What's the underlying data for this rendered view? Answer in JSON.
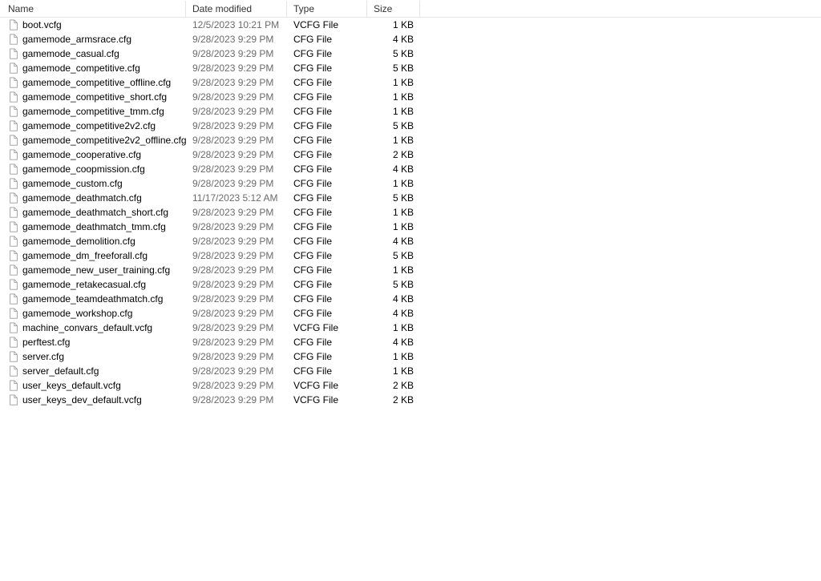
{
  "columns": {
    "name": "Name",
    "date": "Date modified",
    "type": "Type",
    "size": "Size"
  },
  "files": [
    {
      "name": "boot.vcfg",
      "date": "12/5/2023 10:21 PM",
      "type": "VCFG File",
      "size": "1 KB"
    },
    {
      "name": "gamemode_armsrace.cfg",
      "date": "9/28/2023 9:29 PM",
      "type": "CFG File",
      "size": "4 KB"
    },
    {
      "name": "gamemode_casual.cfg",
      "date": "9/28/2023 9:29 PM",
      "type": "CFG File",
      "size": "5 KB"
    },
    {
      "name": "gamemode_competitive.cfg",
      "date": "9/28/2023 9:29 PM",
      "type": "CFG File",
      "size": "5 KB"
    },
    {
      "name": "gamemode_competitive_offline.cfg",
      "date": "9/28/2023 9:29 PM",
      "type": "CFG File",
      "size": "1 KB"
    },
    {
      "name": "gamemode_competitive_short.cfg",
      "date": "9/28/2023 9:29 PM",
      "type": "CFG File",
      "size": "1 KB"
    },
    {
      "name": "gamemode_competitive_tmm.cfg",
      "date": "9/28/2023 9:29 PM",
      "type": "CFG File",
      "size": "1 KB"
    },
    {
      "name": "gamemode_competitive2v2.cfg",
      "date": "9/28/2023 9:29 PM",
      "type": "CFG File",
      "size": "5 KB"
    },
    {
      "name": "gamemode_competitive2v2_offline.cfg",
      "date": "9/28/2023 9:29 PM",
      "type": "CFG File",
      "size": "1 KB"
    },
    {
      "name": "gamemode_cooperative.cfg",
      "date": "9/28/2023 9:29 PM",
      "type": "CFG File",
      "size": "2 KB"
    },
    {
      "name": "gamemode_coopmission.cfg",
      "date": "9/28/2023 9:29 PM",
      "type": "CFG File",
      "size": "4 KB"
    },
    {
      "name": "gamemode_custom.cfg",
      "date": "9/28/2023 9:29 PM",
      "type": "CFG File",
      "size": "1 KB"
    },
    {
      "name": "gamemode_deathmatch.cfg",
      "date": "11/17/2023 5:12 AM",
      "type": "CFG File",
      "size": "5 KB"
    },
    {
      "name": "gamemode_deathmatch_short.cfg",
      "date": "9/28/2023 9:29 PM",
      "type": "CFG File",
      "size": "1 KB"
    },
    {
      "name": "gamemode_deathmatch_tmm.cfg",
      "date": "9/28/2023 9:29 PM",
      "type": "CFG File",
      "size": "1 KB"
    },
    {
      "name": "gamemode_demolition.cfg",
      "date": "9/28/2023 9:29 PM",
      "type": "CFG File",
      "size": "4 KB"
    },
    {
      "name": "gamemode_dm_freeforall.cfg",
      "date": "9/28/2023 9:29 PM",
      "type": "CFG File",
      "size": "5 KB"
    },
    {
      "name": "gamemode_new_user_training.cfg",
      "date": "9/28/2023 9:29 PM",
      "type": "CFG File",
      "size": "1 KB"
    },
    {
      "name": "gamemode_retakecasual.cfg",
      "date": "9/28/2023 9:29 PM",
      "type": "CFG File",
      "size": "5 KB"
    },
    {
      "name": "gamemode_teamdeathmatch.cfg",
      "date": "9/28/2023 9:29 PM",
      "type": "CFG File",
      "size": "4 KB"
    },
    {
      "name": "gamemode_workshop.cfg",
      "date": "9/28/2023 9:29 PM",
      "type": "CFG File",
      "size": "4 KB"
    },
    {
      "name": "machine_convars_default.vcfg",
      "date": "9/28/2023 9:29 PM",
      "type": "VCFG File",
      "size": "1 KB"
    },
    {
      "name": "perftest.cfg",
      "date": "9/28/2023 9:29 PM",
      "type": "CFG File",
      "size": "4 KB"
    },
    {
      "name": "server.cfg",
      "date": "9/28/2023 9:29 PM",
      "type": "CFG File",
      "size": "1 KB"
    },
    {
      "name": "server_default.cfg",
      "date": "9/28/2023 9:29 PM",
      "type": "CFG File",
      "size": "1 KB"
    },
    {
      "name": "user_keys_default.vcfg",
      "date": "9/28/2023 9:29 PM",
      "type": "VCFG File",
      "size": "2 KB"
    },
    {
      "name": "user_keys_dev_default.vcfg",
      "date": "9/28/2023 9:29 PM",
      "type": "VCFG File",
      "size": "2 KB"
    }
  ]
}
